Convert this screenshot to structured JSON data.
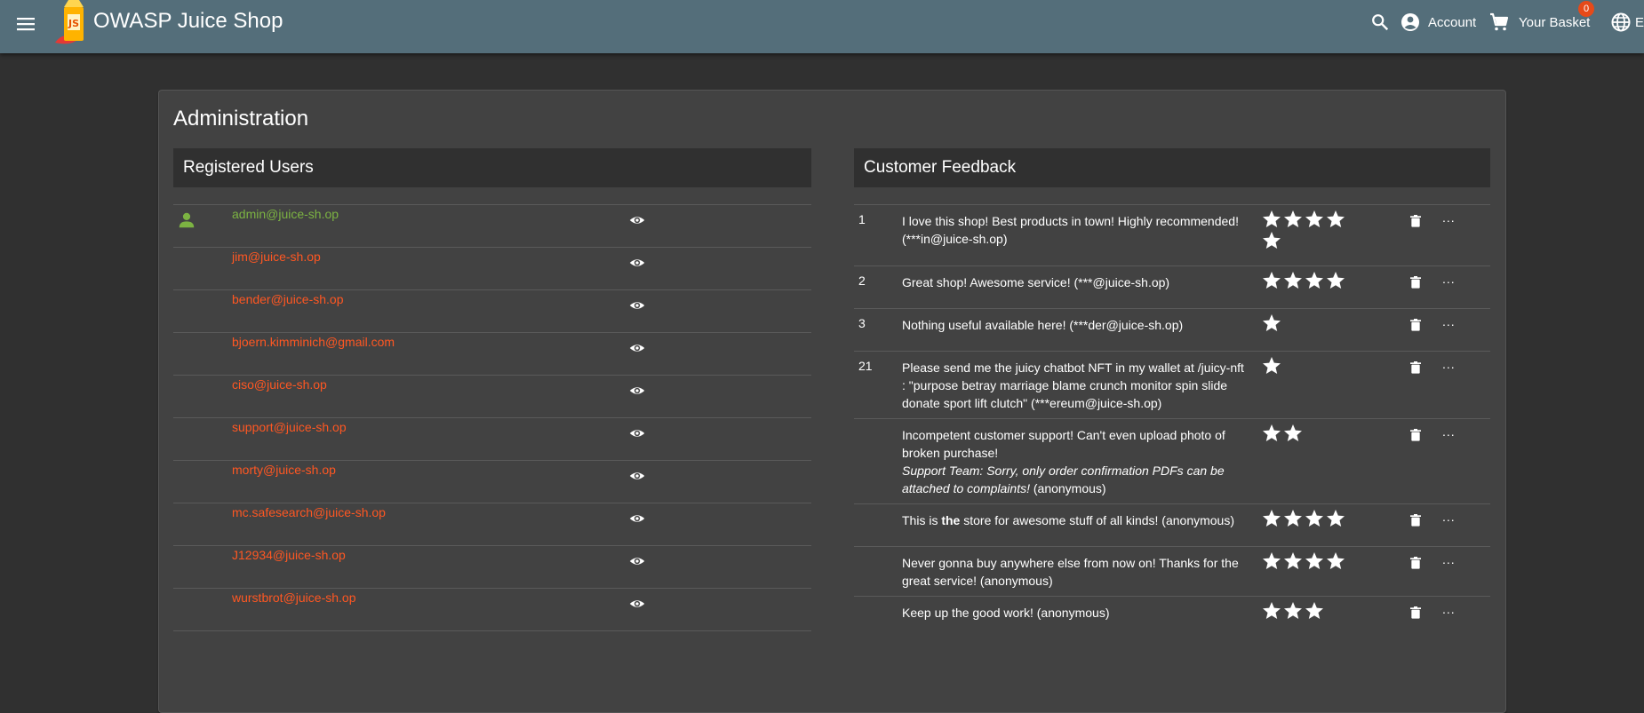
{
  "toolbar": {
    "title": "OWASP Juice Shop",
    "account_label": "Account",
    "basket_label": "Your Basket",
    "basket_count": "0",
    "language_label": "EN"
  },
  "page": {
    "title": "Administration"
  },
  "users_panel": {
    "title": "Registered Users",
    "users": [
      {
        "email": "admin@juice-sh.op",
        "is_admin": true
      },
      {
        "email": "jim@juice-sh.op",
        "is_admin": false
      },
      {
        "email": "bender@juice-sh.op",
        "is_admin": false
      },
      {
        "email": "bjoern.kimminich@gmail.com",
        "is_admin": false
      },
      {
        "email": "ciso@juice-sh.op",
        "is_admin": false
      },
      {
        "email": "support@juice-sh.op",
        "is_admin": false
      },
      {
        "email": "morty@juice-sh.op",
        "is_admin": false
      },
      {
        "email": "mc.safesearch@juice-sh.op",
        "is_admin": false
      },
      {
        "email": "J12934@juice-sh.op",
        "is_admin": false
      },
      {
        "email": "wurstbrot@juice-sh.op",
        "is_admin": false
      }
    ]
  },
  "feedback_panel": {
    "title": "Customer Feedback",
    "items": [
      {
        "id": "1",
        "parts": [
          {
            "t": "I love this shop! Best products in town! Highly recommended! (***in@juice-sh.op)"
          }
        ],
        "rating": 5
      },
      {
        "id": "2",
        "parts": [
          {
            "t": "Great shop! Awesome service! (***@juice-sh.op)"
          }
        ],
        "rating": 4
      },
      {
        "id": "3",
        "parts": [
          {
            "t": "Nothing useful available here! (***der@juice-sh.op)"
          }
        ],
        "rating": 1
      },
      {
        "id": "21",
        "parts": [
          {
            "t": "Please send me the juicy chatbot NFT in my wallet at /juicy-nft : \"purpose betray marriage blame crunch monitor spin slide donate sport lift clutch\" (***ereum@juice-sh.op)"
          }
        ],
        "rating": 1
      },
      {
        "id": "",
        "parts": [
          {
            "t": "Incompetent customer support! Can't even upload photo of broken purchase!"
          },
          {
            "br": true
          },
          {
            "t": "Support Team: Sorry, only order confirmation PDFs can be attached to complaints!",
            "i": true
          },
          {
            "t": " (anonymous)"
          }
        ],
        "rating": 2
      },
      {
        "id": "",
        "parts": [
          {
            "t": "This is "
          },
          {
            "t": "the",
            "b": true
          },
          {
            "t": " store for awesome stuff of all kinds! (anonymous)"
          }
        ],
        "rating": 4
      },
      {
        "id": "",
        "parts": [
          {
            "t": "Never gonna buy anywhere else from now on! Thanks for the great service! (anonymous)"
          }
        ],
        "rating": 4
      },
      {
        "id": "",
        "parts": [
          {
            "t": "Keep up the good work! (anonymous)"
          }
        ],
        "rating": 3
      }
    ],
    "more_label": "..."
  },
  "colors": {
    "toolbar_bg": "#546e7a",
    "page_bg": "#303030",
    "card_bg": "#424242",
    "admin_email": "#7cb342",
    "user_email": "#ff5722",
    "badge": "#e64a19"
  },
  "icons": {
    "menu": "menu-icon",
    "search": "search-icon",
    "account": "account-circle-icon",
    "basket": "shopping-cart-icon",
    "language": "language-globe-icon",
    "user": "person-icon",
    "view": "eye-icon",
    "delete": "trash-icon",
    "rating": "star-icon"
  }
}
